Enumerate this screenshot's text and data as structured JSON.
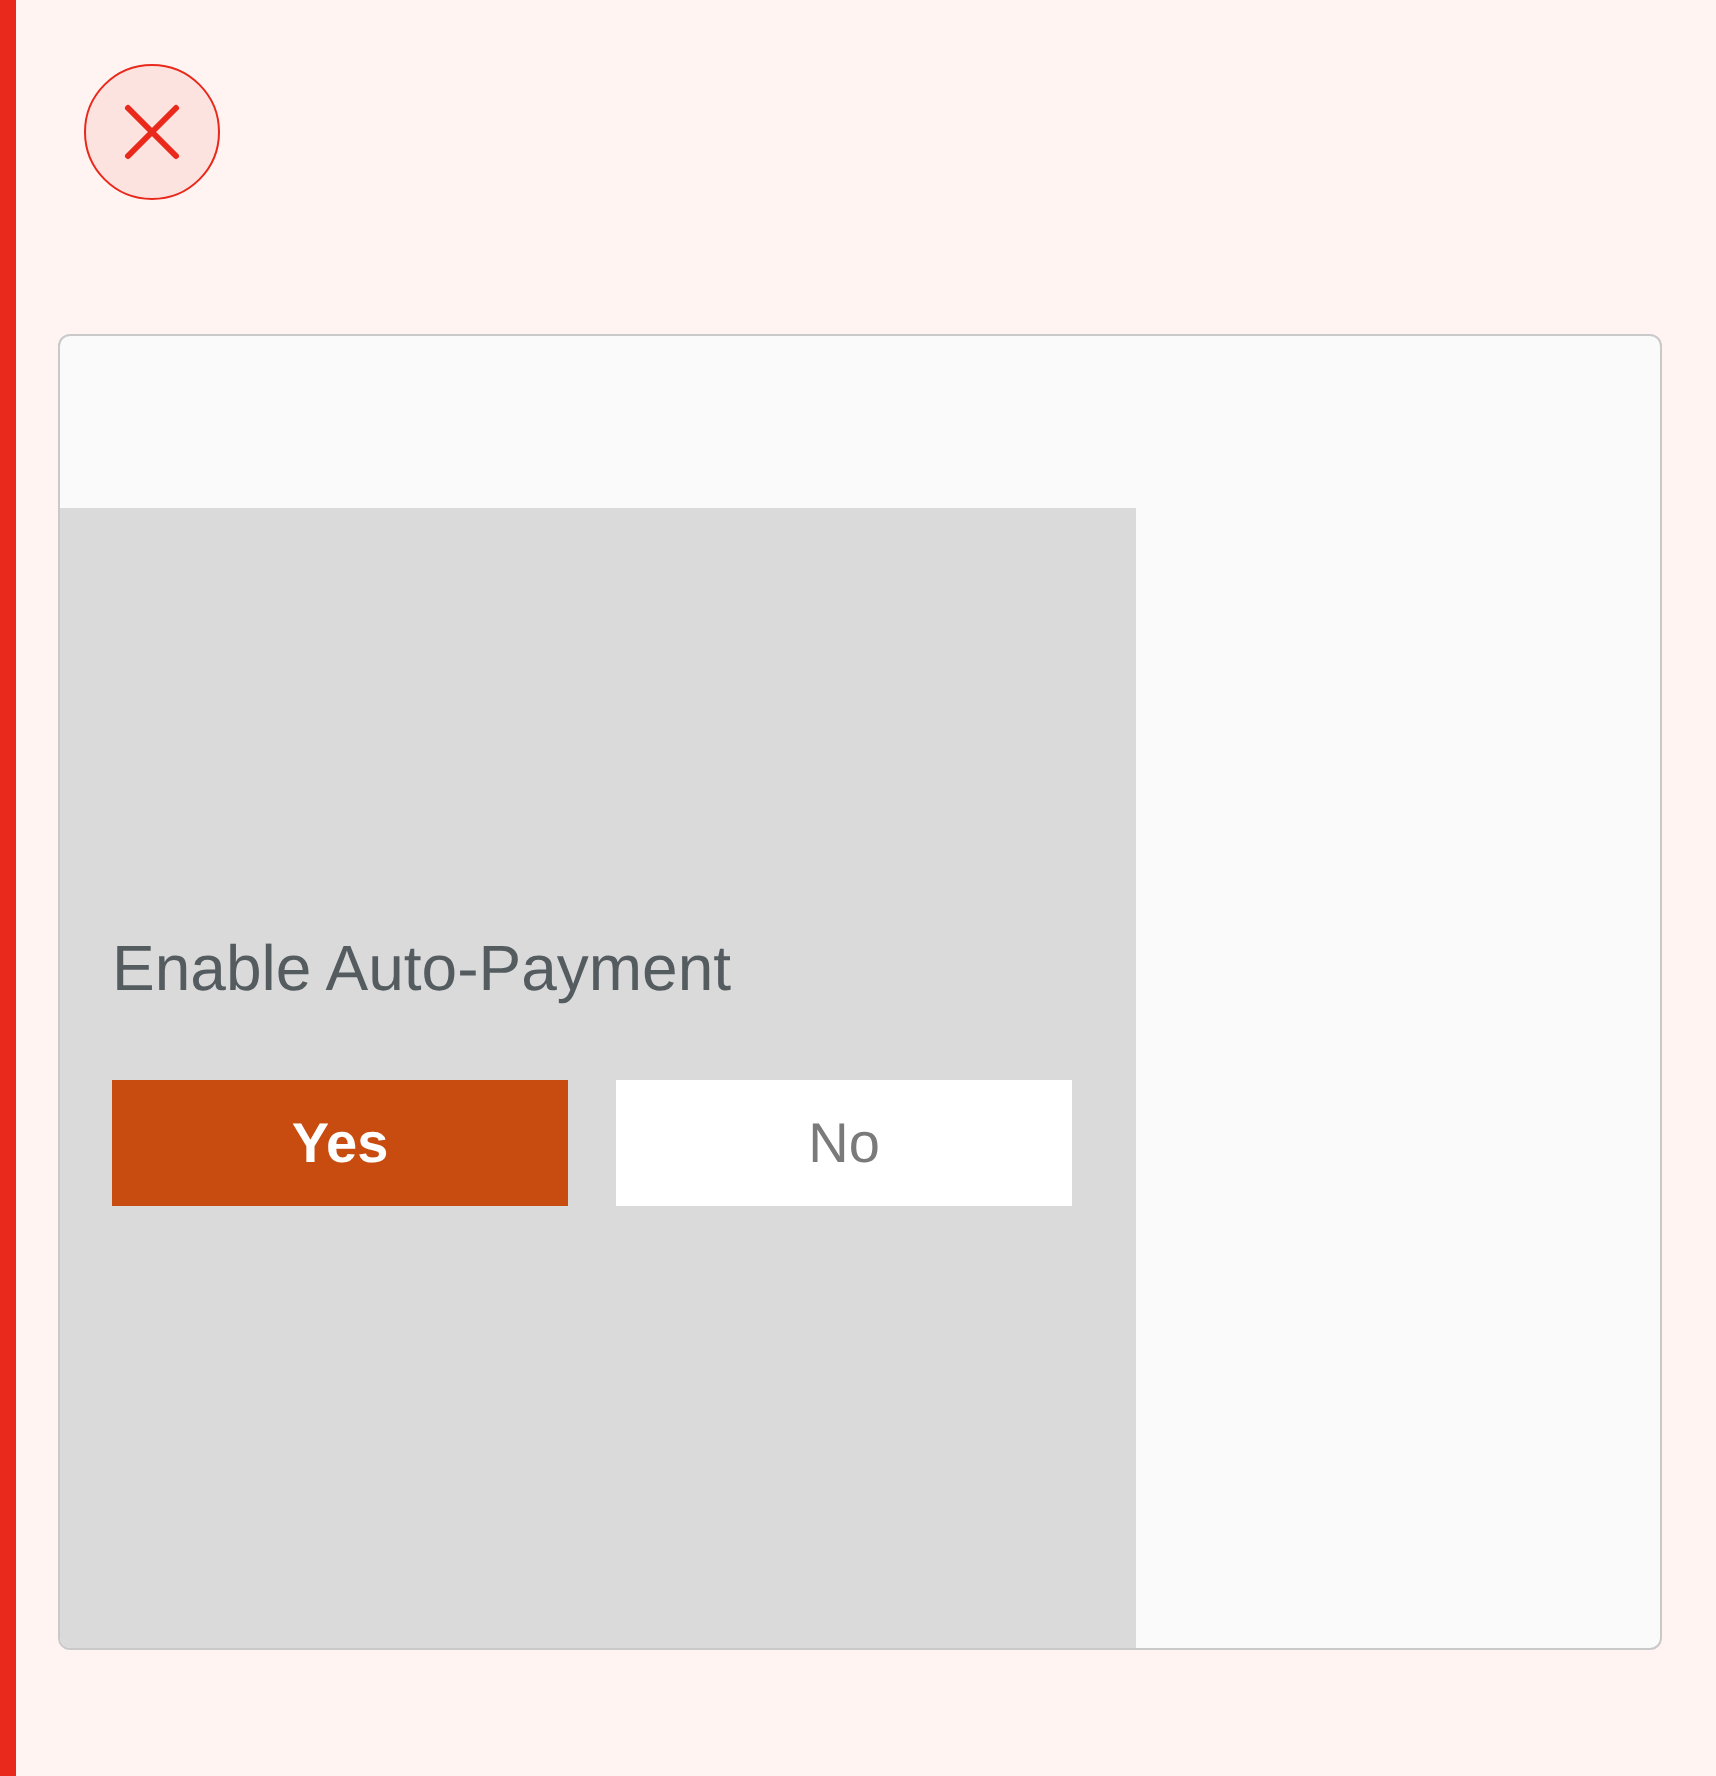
{
  "close_button": {
    "kind": "close"
  },
  "auto_payment": {
    "question": "Enable Auto-Payment",
    "options": [
      {
        "label": "Yes",
        "selected": true
      },
      {
        "label": "No",
        "selected": false
      }
    ]
  }
}
